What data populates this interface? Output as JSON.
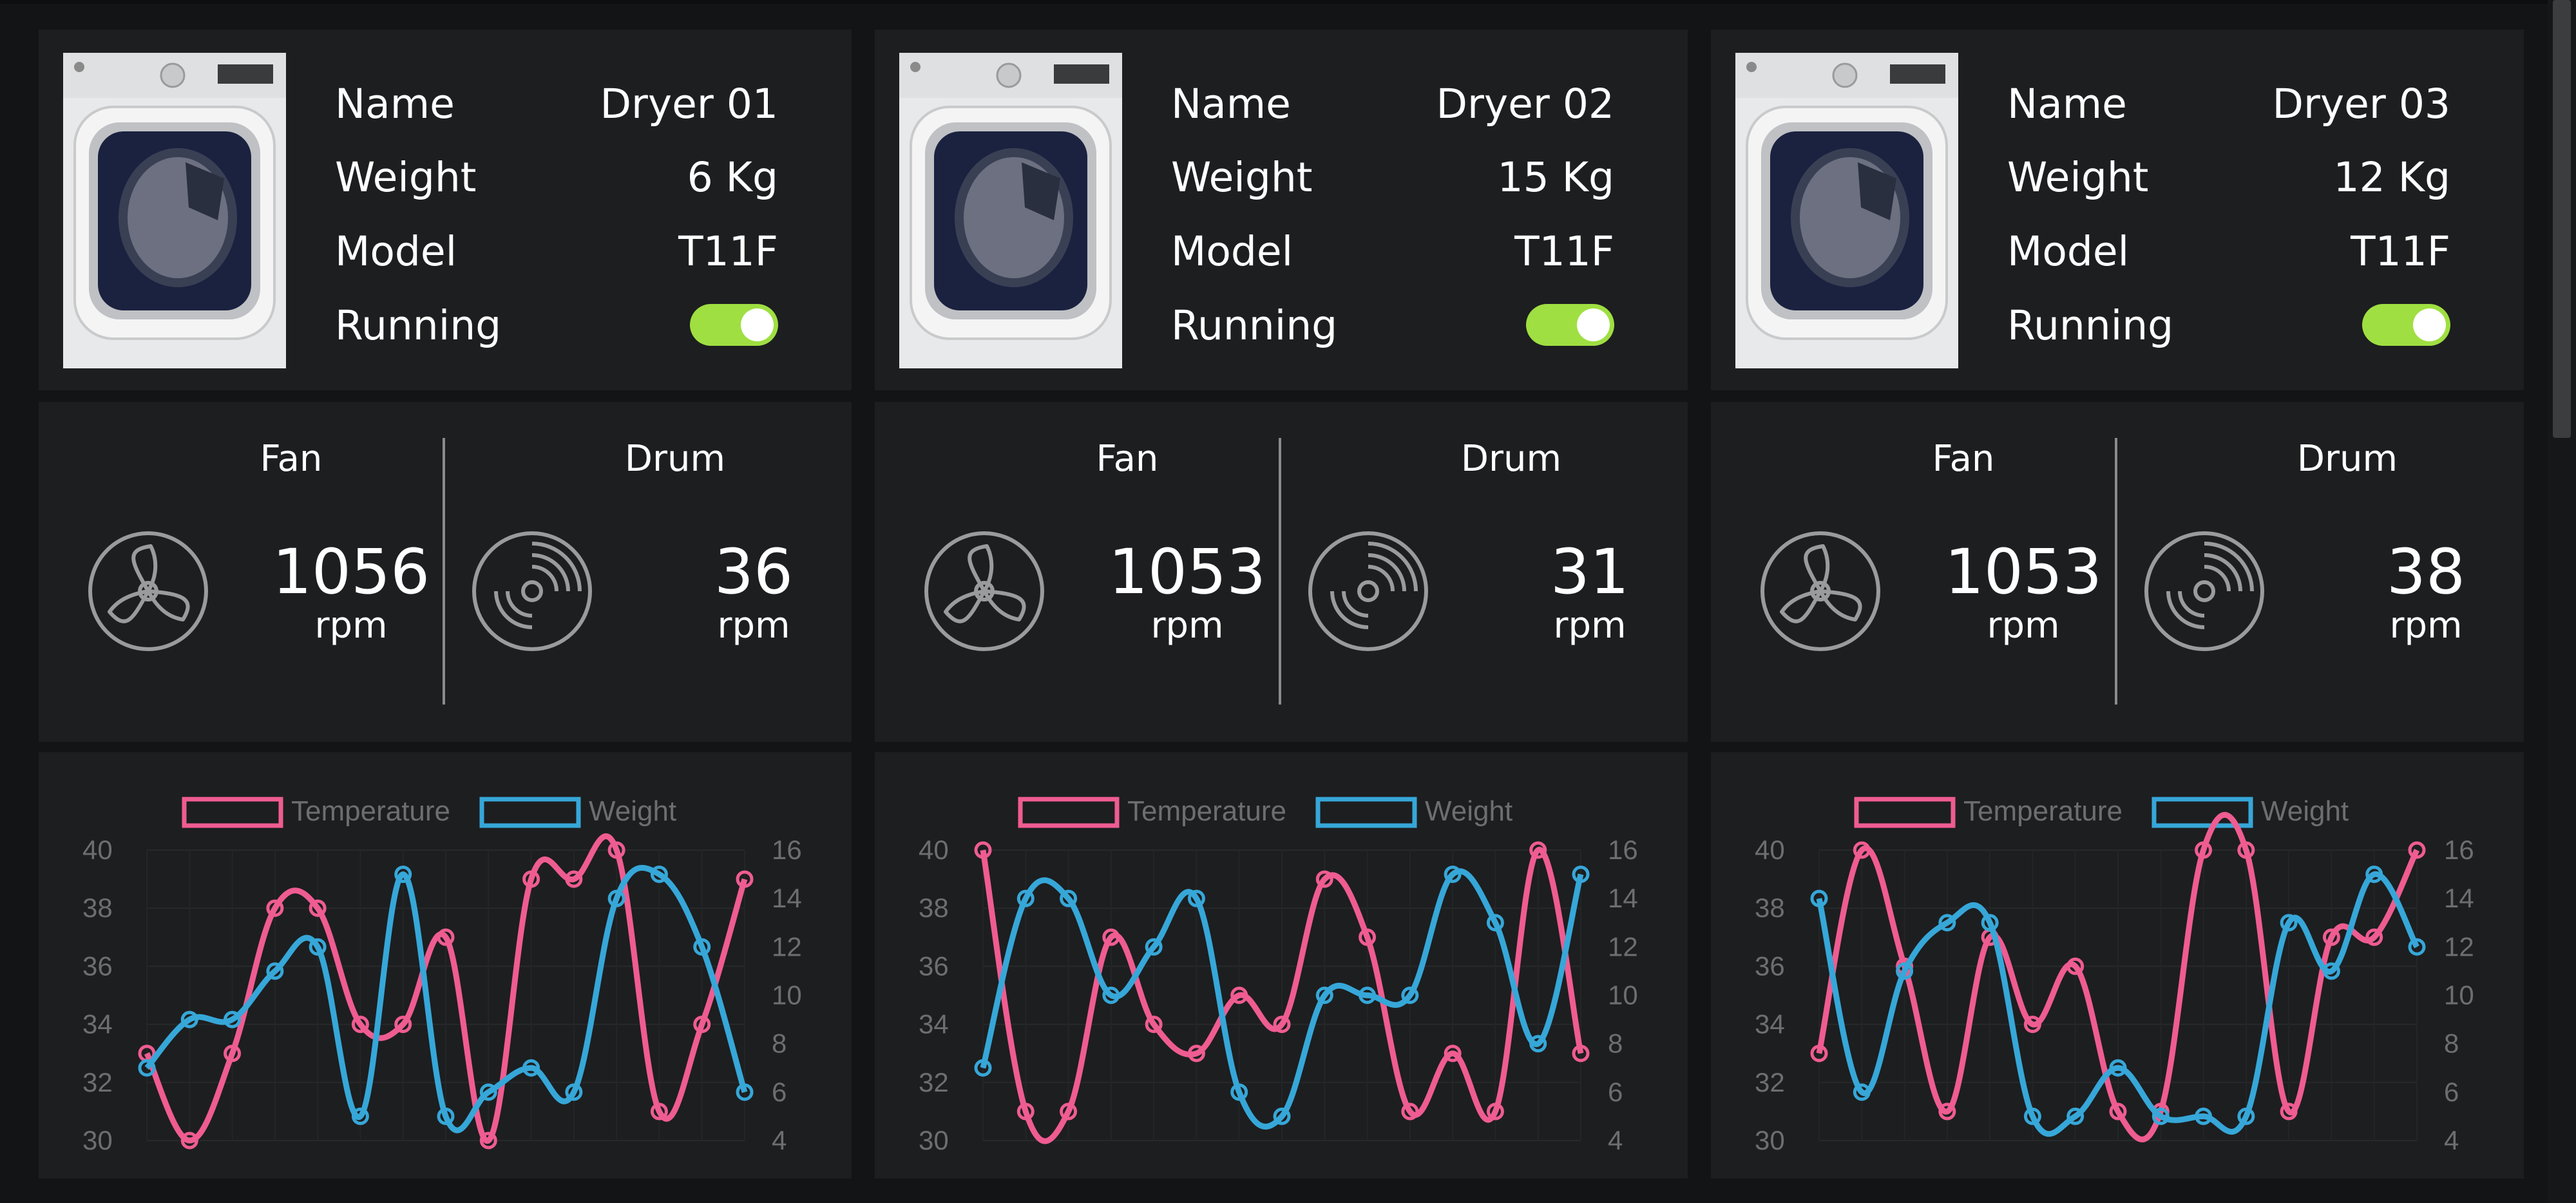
{
  "colors": {
    "background": "#131415",
    "panel": "#1d1e20",
    "toggle_on": "#9fdf42",
    "temperature": "#ef5c91",
    "weight": "#36a7d8",
    "icon": "#9a9b9c",
    "axis_text": "#6c6e70"
  },
  "icons": {
    "fan": "fan-icon",
    "drum": "drum-icon"
  },
  "labels": {
    "name": "Name",
    "weight": "Weight",
    "model": "Model",
    "running": "Running",
    "fan": "Fan",
    "drum": "Drum",
    "rpm": "rpm"
  },
  "dryers": [
    {
      "name": "Dryer 01",
      "weight": "6 Kg",
      "model": "T11F",
      "running": true,
      "fan_rpm": "1056",
      "drum_rpm": "36"
    },
    {
      "name": "Dryer 02",
      "weight": "15 Kg",
      "model": "T11F",
      "running": true,
      "fan_rpm": "1053",
      "drum_rpm": "31"
    },
    {
      "name": "Dryer 03",
      "weight": "12 Kg",
      "model": "T11F",
      "running": true,
      "fan_rpm": "1053",
      "drum_rpm": "38"
    }
  ],
  "chart_data": [
    {
      "type": "line",
      "y_left_lim": [
        30,
        40
      ],
      "y_left_ticks": [
        "30",
        "32",
        "34",
        "36",
        "38",
        "40"
      ],
      "y_right_lim": [
        4,
        16
      ],
      "y_right_ticks": [
        "4",
        "6",
        "8",
        "10",
        "12",
        "14",
        "16"
      ],
      "legend": "top-center",
      "grid": true,
      "series": [
        {
          "name": "Temperature",
          "axis": "left",
          "values": [
            33,
            30,
            33,
            38,
            38,
            34,
            34,
            37,
            30,
            39,
            39,
            40,
            31,
            34,
            39
          ]
        },
        {
          "name": "Weight",
          "axis": "right",
          "values": [
            7,
            9,
            9,
            11,
            12,
            5,
            15,
            5,
            6,
            7,
            6,
            14,
            15,
            12,
            6
          ]
        }
      ]
    },
    {
      "type": "line",
      "y_left_lim": [
        30,
        40
      ],
      "y_left_ticks": [
        "30",
        "32",
        "34",
        "36",
        "38",
        "40"
      ],
      "y_right_lim": [
        4,
        16
      ],
      "y_right_ticks": [
        "4",
        "6",
        "8",
        "10",
        "12",
        "14",
        "16"
      ],
      "legend": "top-center",
      "grid": true,
      "series": [
        {
          "name": "Temperature",
          "axis": "left",
          "values": [
            40,
            31,
            31,
            37,
            34,
            33,
            35,
            34,
            39,
            37,
            31,
            33,
            31,
            40,
            33
          ]
        },
        {
          "name": "Weight",
          "axis": "right",
          "values": [
            7,
            14,
            14,
            10,
            12,
            14,
            6,
            5,
            10,
            10,
            10,
            15,
            13,
            8,
            15
          ]
        }
      ]
    },
    {
      "type": "line",
      "y_left_lim": [
        30,
        40
      ],
      "y_left_ticks": [
        "30",
        "32",
        "34",
        "36",
        "38",
        "40"
      ],
      "y_right_lim": [
        4,
        16
      ],
      "y_right_ticks": [
        "4",
        "6",
        "8",
        "10",
        "12",
        "14",
        "16"
      ],
      "legend": "top-center",
      "grid": true,
      "series": [
        {
          "name": "Temperature",
          "axis": "left",
          "values": [
            33,
            40,
            36,
            31,
            37,
            34,
            36,
            31,
            31,
            40,
            40,
            31,
            37,
            37,
            40
          ]
        },
        {
          "name": "Weight",
          "axis": "right",
          "values": [
            14,
            6,
            11,
            13,
            13,
            5,
            5,
            7,
            5,
            5,
            5,
            13,
            11,
            15,
            12
          ]
        }
      ]
    }
  ]
}
